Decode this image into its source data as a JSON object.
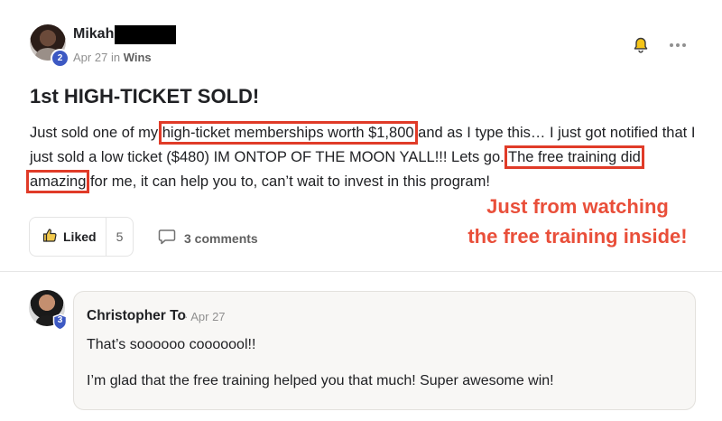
{
  "post": {
    "author": "Mikah",
    "level": "2",
    "date": "Apr 27",
    "in_word": "in",
    "category": "Wins",
    "title": "1st HIGH-TICKET SOLD!",
    "body": {
      "part1": "Just sold one of my ",
      "hl1": "high-ticket memberships worth $1,800",
      "part2": " and as I type this… I just got notified that I just sold a low ticket ($480) IM ONTOP OF THE MOON YALL!!! Lets go. ",
      "hl2": "The free training did amazing",
      "part3": " for me, it can help you to, can’t wait to invest in this program!"
    },
    "like_label": "Liked",
    "like_count": "5",
    "comments_label": "3 comments"
  },
  "annotation": {
    "line1": "Just from watching",
    "line2": "the free training inside!"
  },
  "comment": {
    "author": "Christopher To",
    "level": "3",
    "date": "· Apr 27",
    "line1": "That’s soooooo cooooool!!",
    "line2": "I’m glad that the free training helped you that much! Super awesome win!"
  },
  "colors": {
    "highlight_box": "#e03b28",
    "annotation_text": "#e94f3a",
    "level_badge": "#3d59c3",
    "bell": "#e8b318"
  },
  "icons": [
    "bell-icon",
    "more-icon",
    "thumbs-up-icon",
    "comment-icon",
    "shield-icon"
  ]
}
